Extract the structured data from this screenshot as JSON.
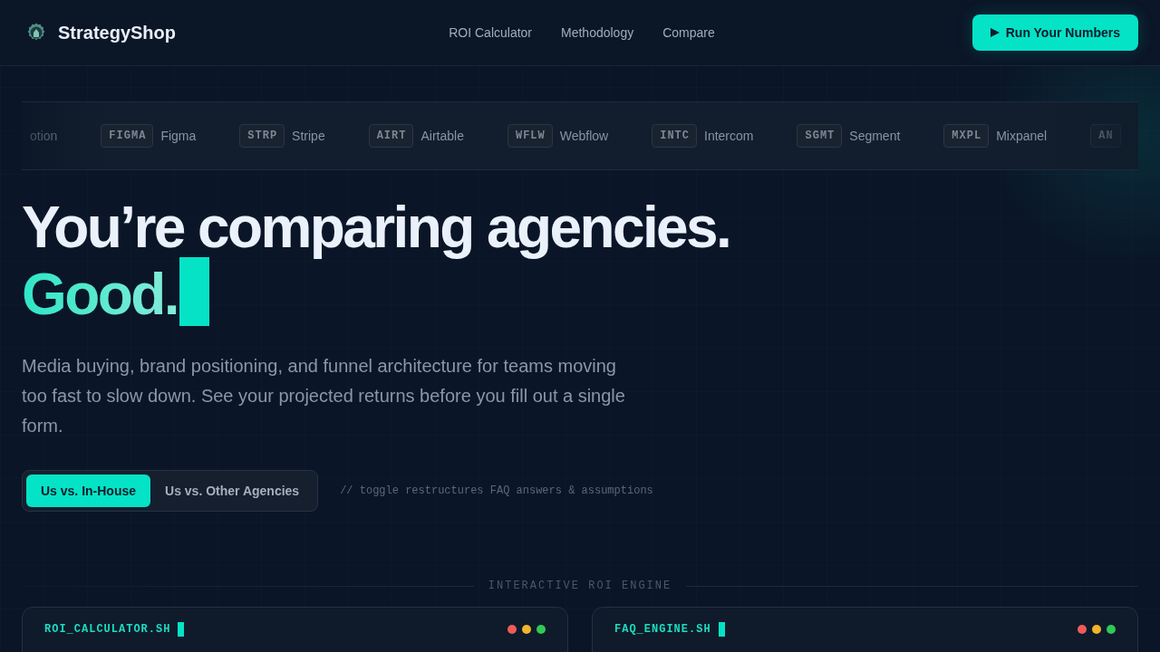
{
  "nav": {
    "brand": "StrategyShop",
    "links": [
      {
        "label": "ROI Calculator"
      },
      {
        "label": "Methodology"
      },
      {
        "label": "Compare"
      }
    ],
    "cta": {
      "label": "Run Your Numbers"
    }
  },
  "tool_strip": [
    {
      "name": "otion"
    },
    {
      "code": "FIGMA",
      "name": "Figma"
    },
    {
      "code": "STRP",
      "name": "Stripe"
    },
    {
      "code": "AIRT",
      "name": "Airtable"
    },
    {
      "code": "WFLW",
      "name": "Webflow"
    },
    {
      "code": "INTC",
      "name": "Intercom"
    },
    {
      "code": "SGMT",
      "name": "Segment"
    },
    {
      "code": "MXPL",
      "name": "Mixpanel"
    },
    {
      "code": "AN"
    }
  ],
  "hero": {
    "headline": "You’re comparing agencies.",
    "highlight": "Good.",
    "description": "Media buying, brand positioning, and funnel architecture for teams moving too fast to slow down. See your projected returns before you fill out a single form.",
    "toggle": [
      {
        "label": "Us vs. In-House",
        "selected": true
      },
      {
        "label": "Us vs. Other Agencies",
        "selected": false
      }
    ],
    "toggle_note": "// toggle restructures FAQ answers & assumptions"
  },
  "section": {
    "label": "INTERACTIVE ROI ENGINE",
    "panels": [
      {
        "title": "ROI_CALCULATOR.SH"
      },
      {
        "title": "FAQ_ENGINE.SH"
      }
    ]
  }
}
